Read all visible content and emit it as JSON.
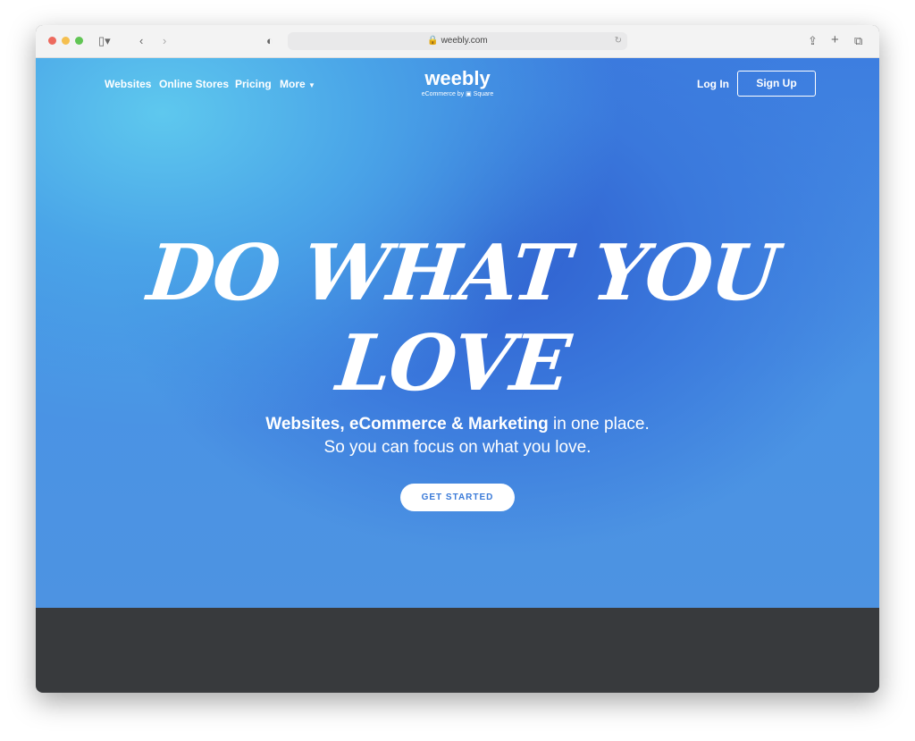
{
  "browser": {
    "url": "weebly.com"
  },
  "nav": {
    "items": [
      "Websites",
      "Online Stores",
      "Pricing",
      "More"
    ],
    "login": "Log In",
    "signup": "Sign Up"
  },
  "logo": {
    "name": "weebly",
    "tagline": "eCommerce by ▣ Square"
  },
  "hero": {
    "headline": "DO WHAT YOU LOVE",
    "sub_bold": "Websites, eCommerce & Marketing",
    "sub_rest": " in one place.",
    "sub_line2": "So you can focus on what you love.",
    "cta": "GET STARTED"
  }
}
